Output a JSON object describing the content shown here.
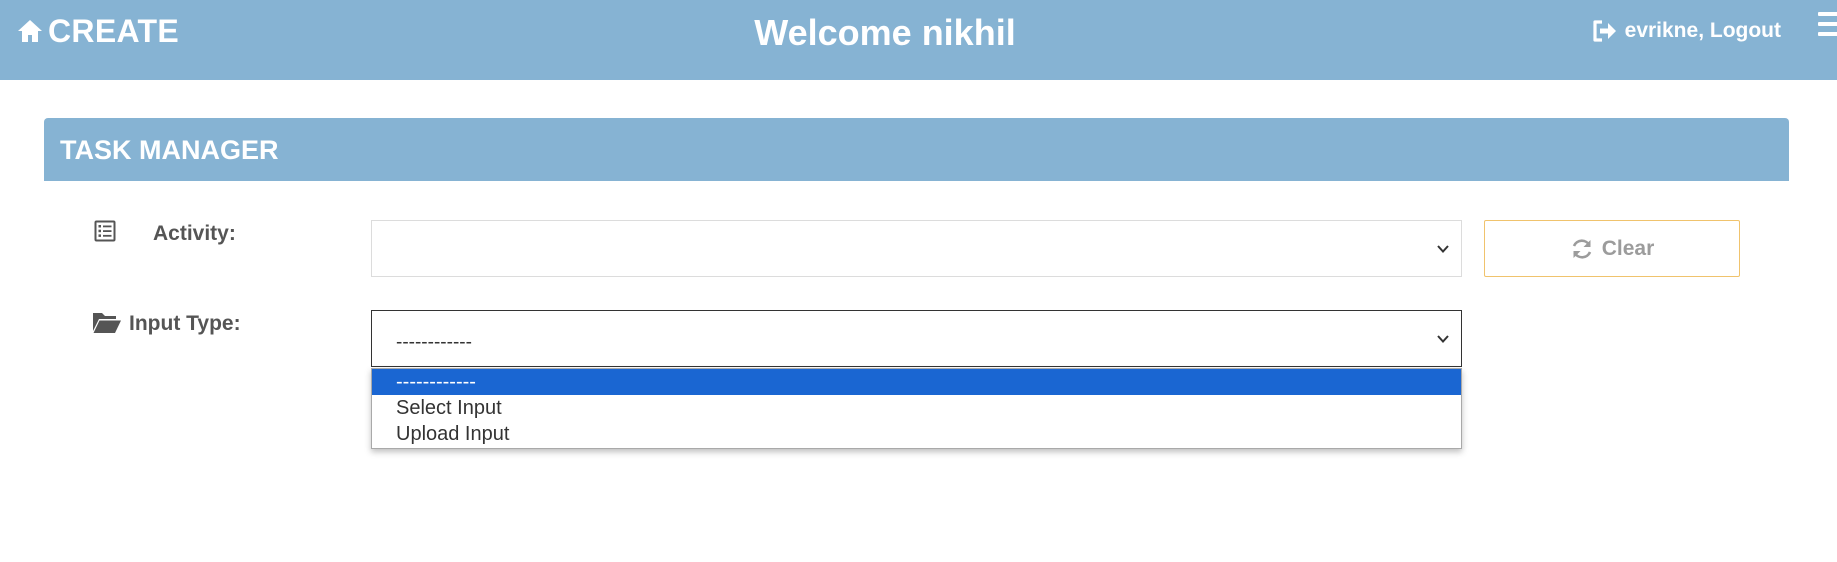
{
  "navbar": {
    "brand_label": "CREATE",
    "welcome_text": "Welcome nikhil",
    "user_text": "evrikne, Logout",
    "icons": {
      "brand": "home-icon",
      "logout": "logout-icon",
      "menu": "hamburger-menu-icon"
    }
  },
  "panel": {
    "title": "TASK MANAGER"
  },
  "form": {
    "activity": {
      "label": "Activity:",
      "icon": "list-icon",
      "value": ""
    },
    "input_type": {
      "label": "Input Type:",
      "icon": "open-folder-icon",
      "value": "------------",
      "options": [
        "------------",
        "Select Input",
        "Upload Input"
      ],
      "highlighted_index": 0
    },
    "clear_button": {
      "label": "Clear",
      "icon": "refresh-icon"
    }
  },
  "colors": {
    "header_blue": "#86b3d3",
    "highlight_blue": "#1a66d2",
    "clear_border": "#f0c36d",
    "label_gray": "#555555"
  }
}
